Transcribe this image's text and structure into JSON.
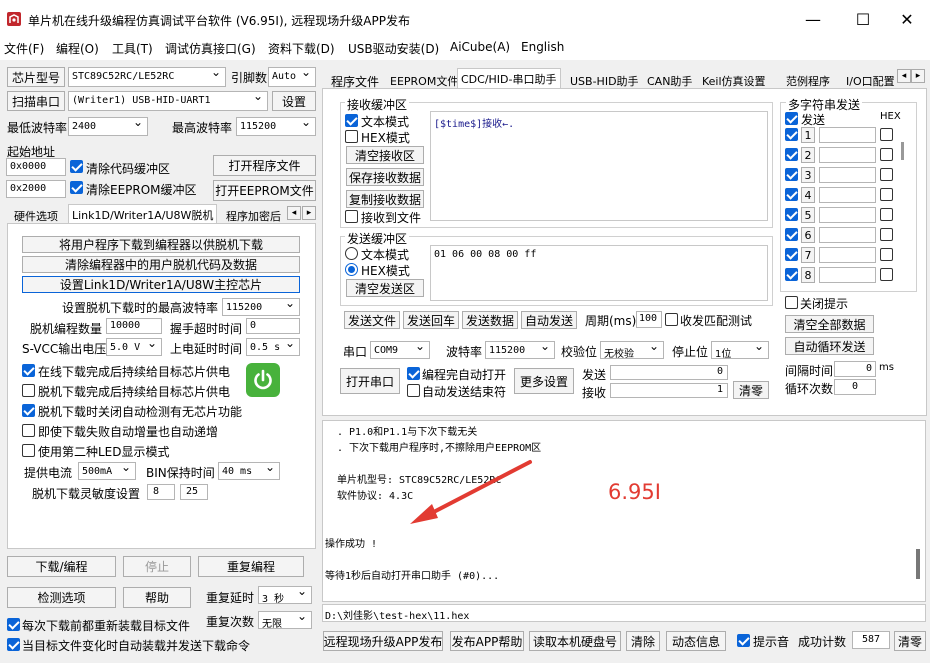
{
  "window": {
    "title": "单片机在线升级编程仿真调试平台软件 (V6.95I), 远程现场升级APP发布",
    "minimize": "—",
    "maximize": "☐",
    "close": "✕"
  },
  "menu": [
    "文件(F)",
    "编程(O)",
    "工具(T)",
    "调试仿真接口(G)",
    "资料下载(D)",
    "USB驱动安装(D)",
    "AiCube(A)",
    "English"
  ],
  "left": {
    "chip_label": "芯片型号",
    "chip_value": "STC89C52RC/LE52RC",
    "pins_label": "引脚数",
    "pins_value": "Auto",
    "scan_button": "扫描串口",
    "port_value": "(Writer1) USB-HID-UART1",
    "settings_button": "设置",
    "min_baud_label": "最低波特率",
    "min_baud_value": "2400",
    "max_baud_label": "最高波特率",
    "max_baud_value": "115200",
    "start_addr_label": "起始地址",
    "addr1_value": "0x0000",
    "clear_code_label": "清除代码缓冲区",
    "open_prog_button": "打开程序文件",
    "addr2_value": "0x2000",
    "clear_eeprom_label": "清除EEPROM缓冲区",
    "open_eeprom_button": "打开EEPROM文件",
    "tabs": [
      "硬件选项",
      "Link1D/Writer1A/U8W脱机",
      "程序加密后"
    ],
    "offline": {
      "btn1": "将用户程序下载到编程器以供脱机下载",
      "btn2": "清除编程器中的用户脱机代码及数据",
      "btn3": "设置Link1D/Writer1A/U8W主控芯片",
      "max_baud_label": "设置脱机下载时的最高波特率",
      "max_baud_value": "115200",
      "count_label": "脱机编程数量",
      "count_value": "10000",
      "timeout_label": "握手超时时间",
      "timeout_value": "0",
      "svcc_label": "S-VCC输出电压",
      "svcc_value": "5.0 V",
      "delay_label": "上电延时时间",
      "delay_value": "0.5 s",
      "opt1": "在线下载完成后持续给目标芯片供电",
      "opt2": "脱机下载完成后持续给目标芯片供电",
      "opt3": "脱机下载时关闭自动检测有无芯片功能",
      "opt4": "即使下载失败自动增量也自动递增",
      "opt5": "使用第二种LED显示模式",
      "current_label": "提供电流",
      "current_value": "500mA",
      "bin_label": "BIN保持时间",
      "bin_value": "40 ms",
      "sens_label": "脱机下载灵敏度设置",
      "sens1": "8",
      "sens2": "25"
    },
    "download_button": "下载/编程",
    "stop_button": "停止",
    "reprog_button": "重复编程",
    "detect_button": "检测选项",
    "help_button": "帮助",
    "repeat_delay_label": "重复延时",
    "repeat_delay_value": "3 秒",
    "repeat_count_label": "重复次数",
    "repeat_count_value": "无限",
    "reload_label": "每次下载前都重新装载目标文件",
    "auto_label": "当目标文件变化时自动装载并发送下载命令"
  },
  "right": {
    "tabs": [
      "程序文件",
      "EEPROM文件",
      "CDC/HID-串口助手",
      "USB-HID助手",
      "CAN助手",
      "Keil仿真设置",
      "范例程序",
      "I/O口配置"
    ],
    "recv": {
      "title": "接收缓冲区",
      "text_mode": "文本模式",
      "hex_mode": "HEX模式",
      "clear": "清空接收区",
      "save": "保存接收数据",
      "copy": "复制接收数据",
      "to_file": "接收到文件",
      "content": "[$time$]接收←."
    },
    "send": {
      "title": "发送缓冲区",
      "text_mode": "文本模式",
      "hex_mode": "HEX模式",
      "clear": "清空发送区",
      "content": "01 06 00 08 00 ff"
    },
    "send_row": {
      "file": "发送文件",
      "enter": "发送回车",
      "data": "发送数据",
      "auto": "自动发送",
      "period_label": "周期(ms)",
      "period_value": "100",
      "match": "收发匹配测试"
    },
    "multi": {
      "title": "多字符串发送",
      "send_label": "发送",
      "hex_label": "HEX",
      "rows": [
        "1",
        "2",
        "3",
        "4",
        "5",
        "6",
        "7",
        "8"
      ],
      "close_prompt": "关闭提示",
      "clear_all": "清空全部数据",
      "auto_loop": "自动循环发送",
      "interval_label": "间隔时间",
      "interval_value": "0",
      "interval_unit": "ms",
      "loop_label": "循环次数",
      "loop_value": "0"
    },
    "port": {
      "port_label": "串口",
      "port_value": "COM9",
      "baud_label": "波特率",
      "baud_value": "115200",
      "parity_label": "校验位",
      "parity_value": "无校验",
      "stop_label": "停止位",
      "stop_value": "1位",
      "open_button": "打开串口",
      "auto_open": "编程完自动打开",
      "auto_end": "自动发送结束符",
      "more_button": "更多设置",
      "sent_label": "发送",
      "sent_value": "0",
      "recv_label": "接收",
      "recv_value": "1",
      "clear_button": "清零"
    },
    "log": {
      "lines": [
        ". P1.0和P1.1与下次下载无关",
        ". 下次下载用户程序时,不擦除用户EEPROM区",
        "",
        "单片机型号: STC89C52RC/LE52RC",
        "软件协议: 4.3C",
        "",
        "",
        "操作成功 !",
        "",
        "等待1秒后自动打开串口助手 (#0)..."
      ],
      "annotation": "6.95I",
      "path": "D:\\刘佳影\\test-hex\\11.hex"
    },
    "bottom": {
      "publish": "远程现场升级APP发布",
      "help": "发布APP帮助",
      "read_disk": "读取本机硬盘号",
      "clear": "清除",
      "dynamic": "动态信息",
      "sound": "提示音",
      "success_label": "成功计数",
      "success_value": "587",
      "reset": "清零"
    }
  },
  "colors": {
    "accent": "#0a64d8",
    "annotation": "#e23b32",
    "power": "#48b23c"
  }
}
